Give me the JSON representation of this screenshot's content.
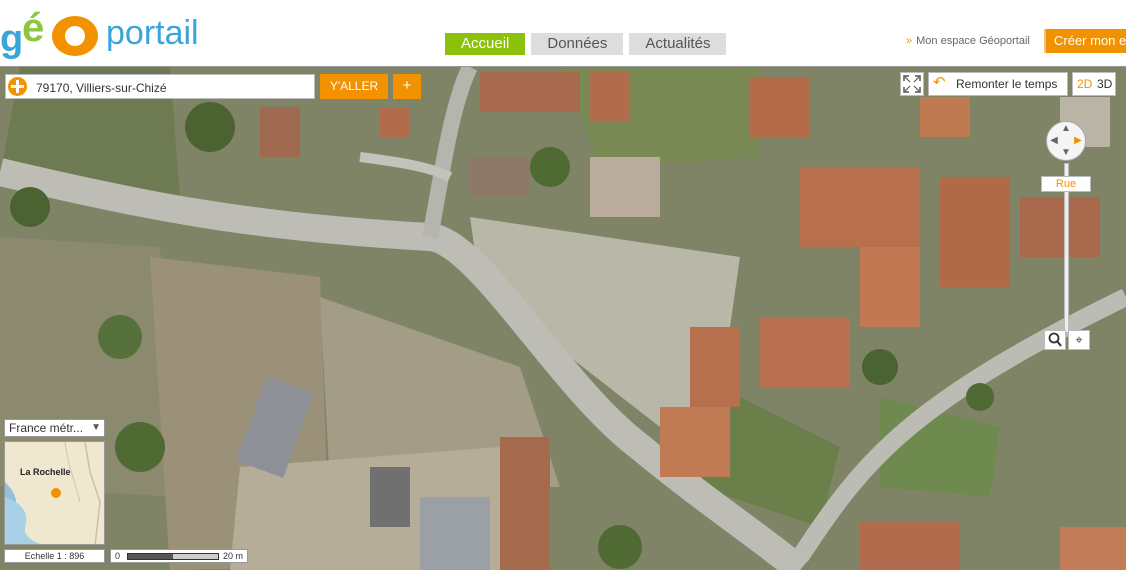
{
  "header": {
    "nav": {
      "accueil": "Accueil",
      "donnees": "Données",
      "actualites": "Actualités"
    },
    "mon_espace": "Mon espace Géoportail",
    "creer": "Créer mon espace"
  },
  "search": {
    "value": "79170, Villiers-sur-Chizé",
    "go_label": "Y'ALLER",
    "plus_label": "+"
  },
  "tools": {
    "remonter": "Remonter le temps",
    "view_2d": "2D",
    "view_3d": "3D"
  },
  "zoom": {
    "level_label": "Rue"
  },
  "overview": {
    "territory": "France métr...",
    "city": "La Rochelle"
  },
  "scale": {
    "ratio_text": "Echelle 1 :  896",
    "zero": "0",
    "distance": "20 m"
  },
  "colors": {
    "accent": "#f39200",
    "active_tab": "#8cc10b",
    "brand_blue": "#3aa6d8"
  }
}
